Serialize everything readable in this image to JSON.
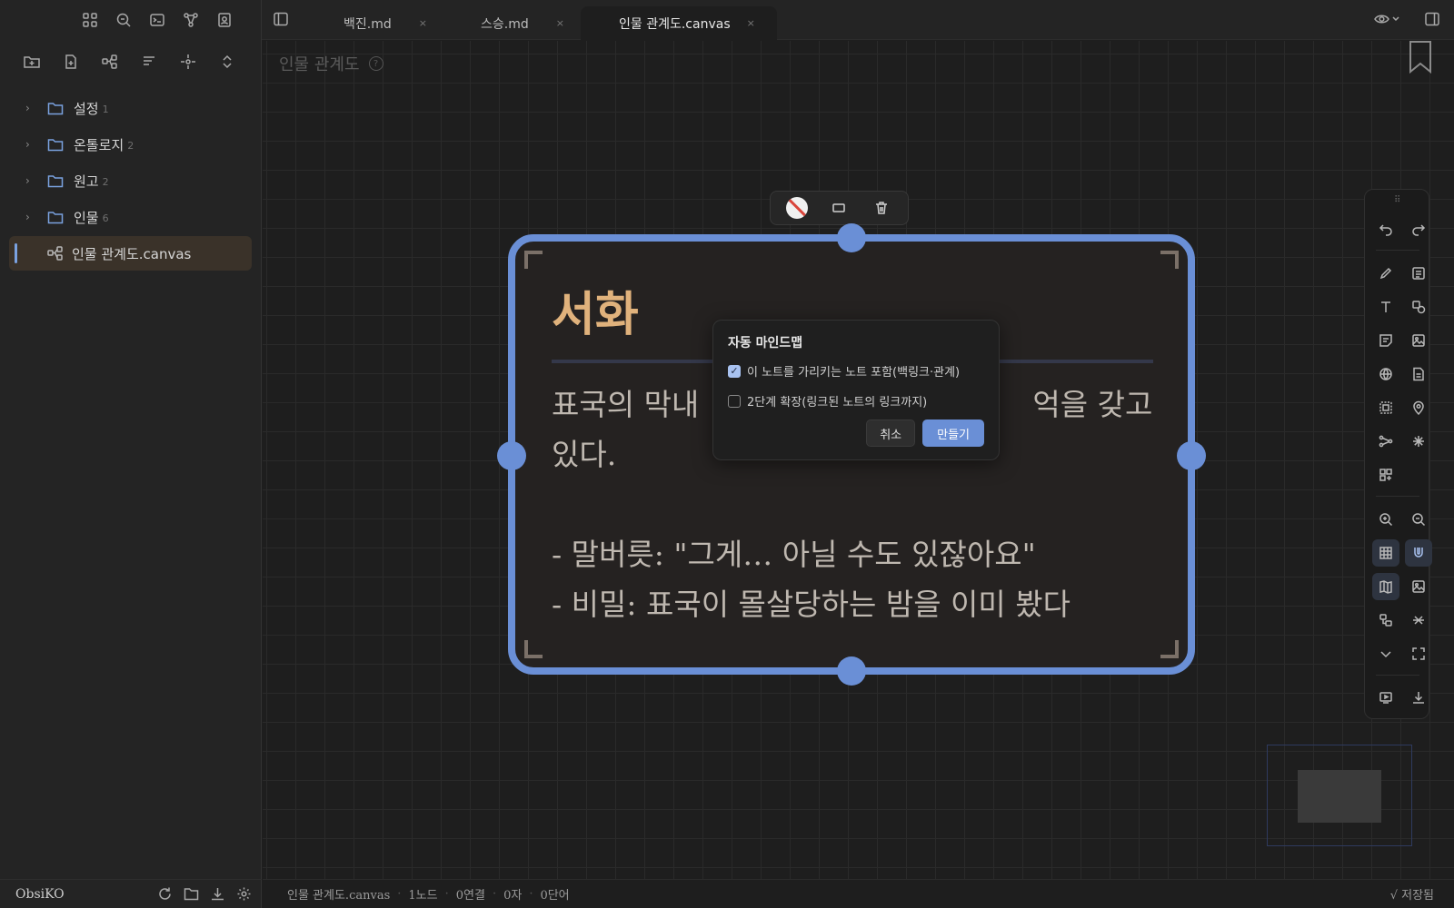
{
  "sidebar": {
    "ribbon_icons": [
      "layout-icon",
      "search-icon",
      "terminal-icon",
      "graph-icon",
      "contact-icon"
    ],
    "explorer_tools": [
      "new-folder-icon",
      "new-file-icon",
      "new-canvas-icon",
      "sort-icon",
      "locate-icon",
      "collapse-icon"
    ],
    "items": [
      {
        "label": "설정",
        "count": "1"
      },
      {
        "label": "온톨로지",
        "count": "2"
      },
      {
        "label": "원고",
        "count": "2"
      },
      {
        "label": "인물",
        "count": "6"
      }
    ],
    "active_item": {
      "label": "인물 관계도.canvas"
    },
    "footer": {
      "vault": "ObsiKO"
    }
  },
  "tabs": [
    {
      "label": "백진.md",
      "close": "×"
    },
    {
      "label": "스승.md",
      "close": "×"
    },
    {
      "label": "인물 관계도.canvas",
      "close": "×"
    }
  ],
  "canvas": {
    "title": "인물 관계도",
    "help": "?",
    "node": {
      "title": "서화",
      "body": "표국의 막내                                   억을 갖고\n있다.\n\n- 말버릇: \"그게… 아닐 수도 있잖아요\"\n- 비밀: 표국이 몰살당하는 밤을 이미 봤다"
    }
  },
  "dialog": {
    "title": "자동 마인드맵",
    "option1": "이 노트를 가리키는 노트 포함(백링크·관계)",
    "option1_checked": true,
    "option2": "2단계 확장(링크된 노트의 링크까지)",
    "option2_checked": false,
    "cancel": "취소",
    "create": "만들기"
  },
  "statusbar": {
    "file": "인물 관계도.canvas",
    "nodes": "1노드",
    "links": "0연결",
    "chars": "0자",
    "words": "0단어",
    "saved": "√ 저장됨"
  },
  "colors": {
    "accent": "#6a8fd6",
    "node_title": "#e0b27c",
    "folder": "#7aa2e0"
  }
}
